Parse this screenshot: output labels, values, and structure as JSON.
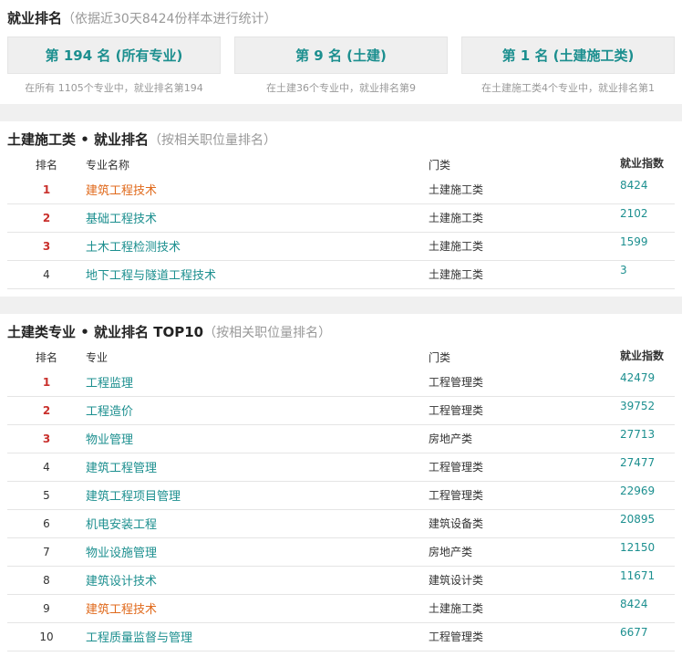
{
  "overview": {
    "title": "就业排名",
    "subtitle": "（依据近30天8424份样本进行统计）",
    "cards": [
      {
        "label": "第 194 名 (所有专业)",
        "desc": "在所有 1105个专业中，就业排名第194"
      },
      {
        "label": "第 9 名 (土建)",
        "desc": "在土建36个专业中，就业排名第9"
      },
      {
        "label": "第 1 名 (土建施工类)",
        "desc": "在土建施工类4个专业中，就业排名第1"
      }
    ]
  },
  "category_ranking": {
    "title": "土建施工类 • 就业排名",
    "subtitle": "（按相关职位量排名）",
    "headers": {
      "rank": "排名",
      "name": "专业名称",
      "category": "门类",
      "index": "就业指数"
    },
    "rows": [
      {
        "rank": "1",
        "name": "建筑工程技术",
        "category": "土建施工类",
        "index": "8424",
        "highlight": true
      },
      {
        "rank": "2",
        "name": "基础工程技术",
        "category": "土建施工类",
        "index": "2102",
        "highlight": false
      },
      {
        "rank": "3",
        "name": "土木工程检测技术",
        "category": "土建施工类",
        "index": "1599",
        "highlight": false
      },
      {
        "rank": "4",
        "name": "地下工程与隧道工程技术",
        "category": "土建施工类",
        "index": "3",
        "highlight": false
      }
    ]
  },
  "top10": {
    "title": "土建类专业 • 就业排名 TOP10",
    "subtitle": "（按相关职位量排名）",
    "headers": {
      "rank": "排名",
      "name": "专业",
      "category": "门类",
      "index": "就业指数"
    },
    "rows": [
      {
        "rank": "1",
        "name": "工程监理",
        "category": "工程管理类",
        "index": "42479",
        "highlight": false
      },
      {
        "rank": "2",
        "name": "工程造价",
        "category": "工程管理类",
        "index": "39752",
        "highlight": false
      },
      {
        "rank": "3",
        "name": "物业管理",
        "category": "房地产类",
        "index": "27713",
        "highlight": false
      },
      {
        "rank": "4",
        "name": "建筑工程管理",
        "category": "工程管理类",
        "index": "27477",
        "highlight": false
      },
      {
        "rank": "5",
        "name": "建筑工程项目管理",
        "category": "工程管理类",
        "index": "22969",
        "highlight": false
      },
      {
        "rank": "6",
        "name": "机电安装工程",
        "category": "建筑设备类",
        "index": "20895",
        "highlight": false
      },
      {
        "rank": "7",
        "name": "物业设施管理",
        "category": "房地产类",
        "index": "12150",
        "highlight": false
      },
      {
        "rank": "8",
        "name": "建筑设计技术",
        "category": "建筑设计类",
        "index": "11671",
        "highlight": false
      },
      {
        "rank": "9",
        "name": "建筑工程技术",
        "category": "土建施工类",
        "index": "8424",
        "highlight": true
      },
      {
        "rank": "10",
        "name": "工程质量监督与管理",
        "category": "工程管理类",
        "index": "6677",
        "highlight": false
      }
    ]
  },
  "colors": {
    "accent": "#1c8f8f",
    "highlight": "#e06a1c",
    "top_rank": "#c9302c"
  }
}
